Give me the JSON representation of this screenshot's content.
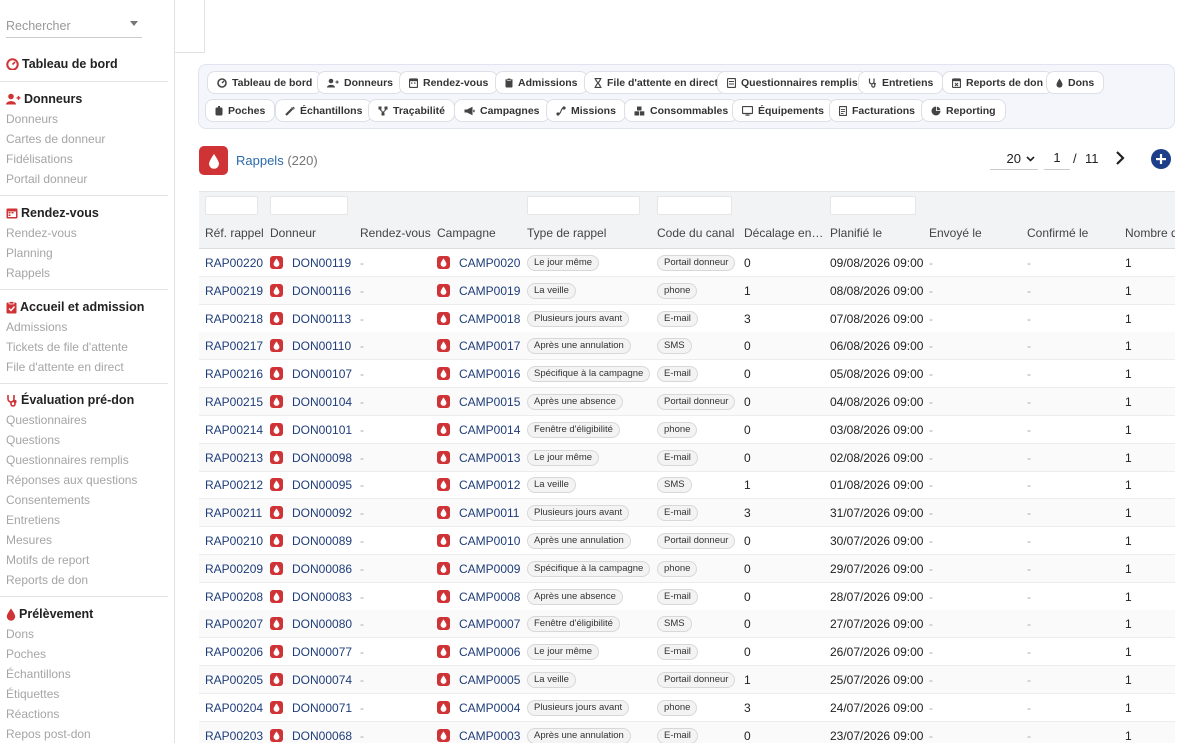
{
  "sidebar": {
    "search_placeholder": "Rechercher",
    "dashboard": "Tableau de bord",
    "sections": [
      {
        "title": "Donneurs",
        "icon": "user-plus-icon",
        "items": [
          "Donneurs",
          "Cartes de donneur",
          "Fidélisations",
          "Portail donneur"
        ]
      },
      {
        "title": "Rendez-vous",
        "icon": "calendar-icon",
        "items": [
          "Rendez-vous",
          "Planning",
          "Rappels"
        ]
      },
      {
        "title": "Accueil et admission",
        "icon": "clipboard-icon",
        "items": [
          "Admissions",
          "Tickets de file d'attente",
          "File d'attente en direct"
        ]
      },
      {
        "title": "Évaluation pré-don",
        "icon": "stethoscope-icon",
        "items": [
          "Questionnaires",
          "Questions",
          "Questionnaires remplis",
          "Réponses aux questions",
          "Consentements",
          "Entretiens",
          "Mesures",
          "Motifs de report",
          "Reports de don"
        ]
      },
      {
        "title": "Prélèvement",
        "icon": "drop-icon",
        "items": [
          "Dons",
          "Poches",
          "Échantillons",
          "Étiquettes",
          "Réactions",
          "Repos post-don"
        ]
      }
    ]
  },
  "quicknav": {
    "row1": [
      {
        "label": "Tableau de bord",
        "icon": "gauge-icon"
      },
      {
        "label": "Donneurs",
        "icon": "user-plus-icon"
      },
      {
        "label": "Rendez-vous",
        "icon": "calendar-icon"
      },
      {
        "label": "Admissions",
        "icon": "clipboard-icon"
      },
      {
        "label": "File d'attente en direct",
        "icon": "hourglass-icon"
      },
      {
        "label": "Questionnaires remplis",
        "icon": "form-icon"
      },
      {
        "label": "Entretiens",
        "icon": "stethoscope-icon"
      },
      {
        "label": "Reports de don",
        "icon": "calendar-x-icon"
      },
      {
        "label": "Dons",
        "icon": "drop-icon"
      }
    ],
    "row2": [
      {
        "label": "Poches",
        "icon": "bag-icon"
      },
      {
        "label": "Échantillons",
        "icon": "syringe-icon"
      },
      {
        "label": "Traçabilité",
        "icon": "network-icon"
      },
      {
        "label": "Campagnes",
        "icon": "megaphone-icon"
      },
      {
        "label": "Missions",
        "icon": "route-icon"
      },
      {
        "label": "Consommables",
        "icon": "boxes-icon"
      },
      {
        "label": "Équipements",
        "icon": "monitor-icon"
      },
      {
        "label": "Facturations",
        "icon": "invoice-icon"
      },
      {
        "label": "Reporting",
        "icon": "pie-chart-icon"
      }
    ]
  },
  "list": {
    "title": "Rappels",
    "count": "(220)",
    "per_page": "20",
    "page": "1",
    "page_sep": "/",
    "total_pages": "11"
  },
  "columns": [
    "Réf. rappel",
    "Donneur",
    "Rendez-vous",
    "Campagne",
    "Type de rappel",
    "Code du canal",
    "Décalage en…",
    "Planifié le",
    "Envoyé le",
    "Confirmé le",
    "Nombre de"
  ],
  "rows": [
    {
      "ref": "RAP00220",
      "donor": "DON00119",
      "rdv": "-",
      "campaign": "CAMP0020",
      "type": "Le jour même",
      "channel": "Portail donneur",
      "offset": "0",
      "planned": "09/08/2026 09:00",
      "sent": "-",
      "confirmed": "-",
      "count": "1"
    },
    {
      "ref": "RAP00219",
      "donor": "DON00116",
      "rdv": "-",
      "campaign": "CAMP0019",
      "type": "La veille",
      "channel": "phone",
      "offset": "1",
      "planned": "08/08/2026 09:00",
      "sent": "-",
      "confirmed": "-",
      "count": "1"
    },
    {
      "ref": "RAP00218",
      "donor": "DON00113",
      "rdv": "-",
      "campaign": "CAMP0018",
      "type": "Plusieurs jours avant",
      "channel": "E-mail",
      "offset": "3",
      "planned": "07/08/2026 09:00",
      "sent": "-",
      "confirmed": "-",
      "count": "1"
    },
    {
      "ref": "RAP00217",
      "donor": "DON00110",
      "rdv": "-",
      "campaign": "CAMP0017",
      "type": "Après une annulation",
      "channel": "SMS",
      "offset": "0",
      "planned": "06/08/2026 09:00",
      "sent": "-",
      "confirmed": "-",
      "count": "1"
    },
    {
      "ref": "RAP00216",
      "donor": "DON00107",
      "rdv": "-",
      "campaign": "CAMP0016",
      "type": "Spécifique à la campagne",
      "channel": "E-mail",
      "offset": "0",
      "planned": "05/08/2026 09:00",
      "sent": "-",
      "confirmed": "-",
      "count": "1"
    },
    {
      "ref": "RAP00215",
      "donor": "DON00104",
      "rdv": "-",
      "campaign": "CAMP0015",
      "type": "Après une absence",
      "channel": "Portail donneur",
      "offset": "0",
      "planned": "04/08/2026 09:00",
      "sent": "-",
      "confirmed": "-",
      "count": "1"
    },
    {
      "ref": "RAP00214",
      "donor": "DON00101",
      "rdv": "-",
      "campaign": "CAMP0014",
      "type": "Fenêtre d'éligibilité",
      "channel": "phone",
      "offset": "0",
      "planned": "03/08/2026 09:00",
      "sent": "-",
      "confirmed": "-",
      "count": "1"
    },
    {
      "ref": "RAP00213",
      "donor": "DON00098",
      "rdv": "-",
      "campaign": "CAMP0013",
      "type": "Le jour même",
      "channel": "E-mail",
      "offset": "0",
      "planned": "02/08/2026 09:00",
      "sent": "-",
      "confirmed": "-",
      "count": "1"
    },
    {
      "ref": "RAP00212",
      "donor": "DON00095",
      "rdv": "-",
      "campaign": "CAMP0012",
      "type": "La veille",
      "channel": "SMS",
      "offset": "1",
      "planned": "01/08/2026 09:00",
      "sent": "-",
      "confirmed": "-",
      "count": "1"
    },
    {
      "ref": "RAP00211",
      "donor": "DON00092",
      "rdv": "-",
      "campaign": "CAMP0011",
      "type": "Plusieurs jours avant",
      "channel": "E-mail",
      "offset": "3",
      "planned": "31/07/2026 09:00",
      "sent": "-",
      "confirmed": "-",
      "count": "1"
    },
    {
      "ref": "RAP00210",
      "donor": "DON00089",
      "rdv": "-",
      "campaign": "CAMP0010",
      "type": "Après une annulation",
      "channel": "Portail donneur",
      "offset": "0",
      "planned": "30/07/2026 09:00",
      "sent": "-",
      "confirmed": "-",
      "count": "1"
    },
    {
      "ref": "RAP00209",
      "donor": "DON00086",
      "rdv": "-",
      "campaign": "CAMP0009",
      "type": "Spécifique à la campagne",
      "channel": "phone",
      "offset": "0",
      "planned": "29/07/2026 09:00",
      "sent": "-",
      "confirmed": "-",
      "count": "1"
    },
    {
      "ref": "RAP00208",
      "donor": "DON00083",
      "rdv": "-",
      "campaign": "CAMP0008",
      "type": "Après une absence",
      "channel": "E-mail",
      "offset": "0",
      "planned": "28/07/2026 09:00",
      "sent": "-",
      "confirmed": "-",
      "count": "1"
    },
    {
      "ref": "RAP00207",
      "donor": "DON00080",
      "rdv": "-",
      "campaign": "CAMP0007",
      "type": "Fenêtre d'éligibilité",
      "channel": "SMS",
      "offset": "0",
      "planned": "27/07/2026 09:00",
      "sent": "-",
      "confirmed": "-",
      "count": "1"
    },
    {
      "ref": "RAP00206",
      "donor": "DON00077",
      "rdv": "-",
      "campaign": "CAMP0006",
      "type": "Le jour même",
      "channel": "E-mail",
      "offset": "0",
      "planned": "26/07/2026 09:00",
      "sent": "-",
      "confirmed": "-",
      "count": "1"
    },
    {
      "ref": "RAP00205",
      "donor": "DON00074",
      "rdv": "-",
      "campaign": "CAMP0005",
      "type": "La veille",
      "channel": "Portail donneur",
      "offset": "1",
      "planned": "25/07/2026 09:00",
      "sent": "-",
      "confirmed": "-",
      "count": "1"
    },
    {
      "ref": "RAP00204",
      "donor": "DON00071",
      "rdv": "-",
      "campaign": "CAMP0004",
      "type": "Plusieurs jours avant",
      "channel": "phone",
      "offset": "3",
      "planned": "24/07/2026 09:00",
      "sent": "-",
      "confirmed": "-",
      "count": "1"
    },
    {
      "ref": "RAP00203",
      "donor": "DON00068",
      "rdv": "-",
      "campaign": "CAMP0003",
      "type": "Après une annulation",
      "channel": "E-mail",
      "offset": "0",
      "planned": "23/07/2026 09:00",
      "sent": "-",
      "confirmed": "-",
      "count": "1"
    }
  ],
  "colors": {
    "accent": "#cf3336",
    "link": "#1f3d7a",
    "title": "#2a6aa8",
    "add_button": "#1d3f8a"
  }
}
